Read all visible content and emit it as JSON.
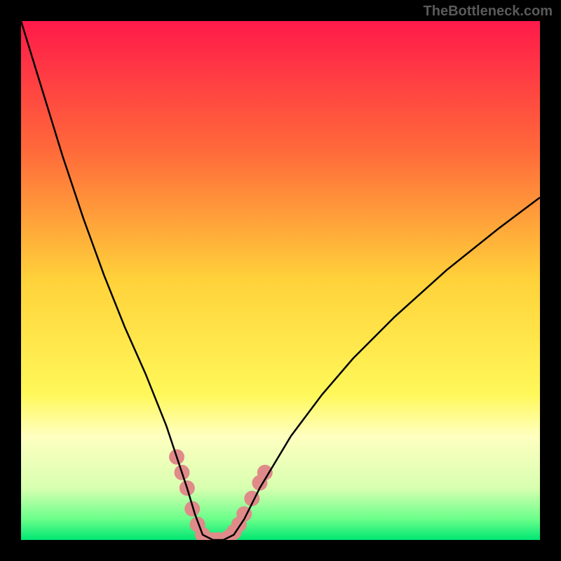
{
  "watermark": "TheBottleneck.com",
  "chart_data": {
    "type": "line",
    "title": "",
    "xlabel": "",
    "ylabel": "",
    "xlim": [
      0,
      100
    ],
    "ylim": [
      0,
      100
    ],
    "background": {
      "type": "vertical-gradient",
      "stops": [
        {
          "offset": 0,
          "color": "#ff1a4a"
        },
        {
          "offset": 25,
          "color": "#ff6a3a"
        },
        {
          "offset": 50,
          "color": "#ffd23a"
        },
        {
          "offset": 72,
          "color": "#fff85a"
        },
        {
          "offset": 80,
          "color": "#ffffc0"
        },
        {
          "offset": 90,
          "color": "#d8ffb0"
        },
        {
          "offset": 96,
          "color": "#6aff8a"
        },
        {
          "offset": 100,
          "color": "#00e672"
        }
      ]
    },
    "series": [
      {
        "name": "bottleneck-curve",
        "color": "#000000",
        "x": [
          0,
          4,
          8,
          12,
          16,
          20,
          24,
          28,
          30,
          32,
          33.5,
          35,
          37,
          39,
          41,
          43,
          46,
          52,
          58,
          64,
          72,
          82,
          92,
          100
        ],
        "y": [
          100,
          87,
          74,
          62,
          51,
          41,
          32,
          22,
          16,
          10,
          5,
          1,
          0,
          0,
          1,
          4,
          10,
          20,
          28,
          35,
          43,
          52,
          60,
          66
        ]
      }
    ],
    "markers": {
      "name": "highlight-band",
      "color": "#e08a8a",
      "points": [
        {
          "x": 30,
          "y": 16
        },
        {
          "x": 31,
          "y": 13
        },
        {
          "x": 32,
          "y": 10
        },
        {
          "x": 33,
          "y": 6
        },
        {
          "x": 34,
          "y": 3
        },
        {
          "x": 35,
          "y": 1
        },
        {
          "x": 36,
          "y": 0
        },
        {
          "x": 37,
          "y": 0
        },
        {
          "x": 38,
          "y": 0
        },
        {
          "x": 39,
          "y": 0
        },
        {
          "x": 40,
          "y": 0.5
        },
        {
          "x": 41,
          "y": 1.5
        },
        {
          "x": 42,
          "y": 3
        },
        {
          "x": 43,
          "y": 5
        },
        {
          "x": 44.5,
          "y": 8
        },
        {
          "x": 46,
          "y": 11
        },
        {
          "x": 47,
          "y": 13
        }
      ]
    }
  }
}
